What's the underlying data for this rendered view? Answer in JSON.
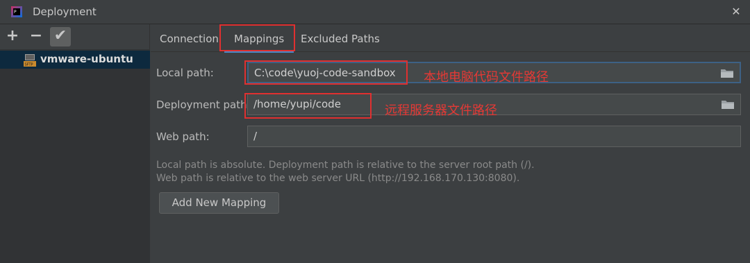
{
  "window": {
    "title": "Deployment"
  },
  "toolbar": {
    "add_label": "+",
    "remove_label": "−",
    "apply_label": "✔"
  },
  "servers": [
    {
      "label": "vmware-ubuntu",
      "icon": "sftp-icon"
    }
  ],
  "tabs": [
    {
      "label": "Connection",
      "active": false
    },
    {
      "label": "Mappings",
      "active": true
    },
    {
      "label": "Excluded Paths",
      "active": false
    }
  ],
  "fields": {
    "local_path": {
      "label": "Local path:",
      "value": "C:\\code\\yuoj-code-sandbox"
    },
    "deployment_path": {
      "label": "Deployment path:",
      "value": "/home/yupi/code"
    },
    "web_path": {
      "label": "Web path:",
      "value": "/"
    }
  },
  "annotations": {
    "local": "本地电脑代码文件路径",
    "remote": "远程服务器文件路径"
  },
  "hints": {
    "line1": "Local path is absolute. Deployment path is relative to the server root path (/).",
    "line2": "Web path is relative to the web server URL (http://192.168.170.130:8080)."
  },
  "buttons": {
    "add_mapping": "Add New Mapping"
  },
  "colors": {
    "accent": "#4a88c7",
    "annotation": "#e03030",
    "selection": "#0d293e"
  }
}
